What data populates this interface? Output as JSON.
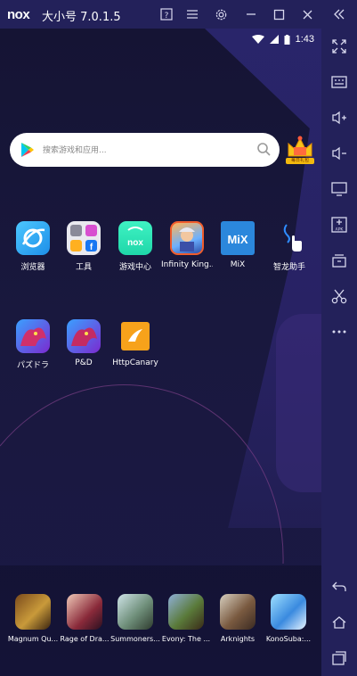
{
  "window": {
    "logo_text": "nox",
    "title": "大小号 7.0.1.5"
  },
  "title_buttons": [
    "help-icon",
    "menu-icon",
    "settings-icon",
    "minimize-icon",
    "maximize-icon",
    "close-icon",
    "collapse-icon"
  ],
  "status_bar": {
    "time": "1:43"
  },
  "search": {
    "placeholder": "搜索游戏和应用..."
  },
  "gift": {
    "label": "每日礼包"
  },
  "apps_row1": [
    {
      "label": "浏览器",
      "icon": "browser-icon"
    },
    {
      "label": "工具",
      "icon": "tools-folder-icon"
    },
    {
      "label": "游戏中心",
      "icon": "game-center-icon"
    },
    {
      "label": "Infinity King...",
      "icon": "infinity-kingdom-icon"
    },
    {
      "label": "MiX",
      "icon": "mix-icon"
    },
    {
      "label": "智龙助手",
      "icon": "dragon-assistant-icon"
    }
  ],
  "apps_row2": [
    {
      "label": "パズドラ",
      "icon": "puzzle-dragons-icon"
    },
    {
      "label": "P&D",
      "icon": "pd-icon"
    },
    {
      "label": "HttpCanary",
      "icon": "httpcanary-icon"
    }
  ],
  "dock": [
    {
      "label": "Magnum Qu...",
      "icon": "magnum-quest-icon"
    },
    {
      "label": "Rage of Dra...",
      "icon": "rage-of-dragons-icon"
    },
    {
      "label": "Summoners...",
      "icon": "summoners-war-icon"
    },
    {
      "label": "Evony: The ...",
      "icon": "evony-icon"
    },
    {
      "label": "Arknights",
      "icon": "arknights-icon"
    },
    {
      "label": "KonoSuba:...",
      "icon": "konosuba-icon"
    }
  ],
  "toolbar_tools": [
    "fullscreen-icon",
    "keyboard-icon",
    "volume-up-icon",
    "volume-down-icon",
    "screen-icon",
    "apk-install-icon",
    "multi-instance-icon",
    "scissors-icon",
    "more-icon",
    "back-icon",
    "home-icon",
    "recents-icon"
  ],
  "colors": {
    "frame": "#23215a",
    "screen_bg": "#19183e",
    "accent": "#f3b90e"
  }
}
